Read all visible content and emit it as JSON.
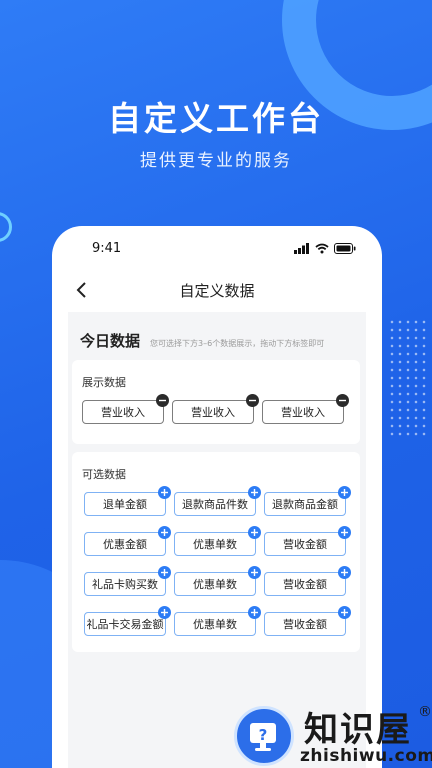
{
  "hero": {
    "title": "自定义工作台",
    "subtitle": "提供更专业的服务"
  },
  "status_bar": {
    "time": "9:41"
  },
  "nav": {
    "title": "自定义数据"
  },
  "today": {
    "title": "今日数据",
    "hint": "您可选择下方3–6个数据展示，拖动下方标签即可"
  },
  "shown": {
    "title": "展示数据",
    "items": [
      "营业收入",
      "营业收入",
      "营业收入"
    ]
  },
  "optional": {
    "title": "可选数据",
    "items": [
      "退单金额",
      "退款商品件数",
      "退款商品金额",
      "优惠金额",
      "优惠单数",
      "营收金额",
      "礼品卡购买数",
      "优惠单数",
      "营收金额",
      "礼品卡交易金额",
      "优惠单数",
      "营收金额"
    ]
  },
  "watermark": {
    "name": "知识屋",
    "registered": "®",
    "domain": "zhishiwu.com"
  },
  "colors": {
    "brand": "#2d7cf5",
    "background": "#1f63e8"
  }
}
